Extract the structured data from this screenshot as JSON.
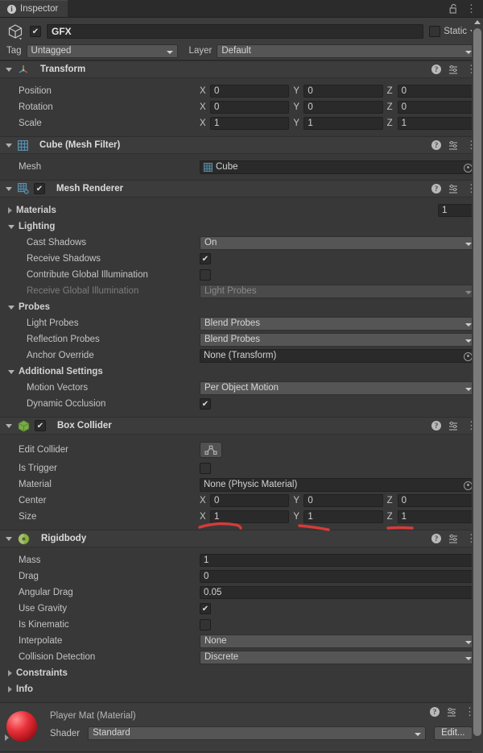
{
  "window": {
    "tab_label": "Inspector",
    "tab_icon": "info-icon",
    "lock_icon": "lock-open-icon",
    "menu_icon": "kebab-menu-icon"
  },
  "object_header": {
    "icon": "cube-icon",
    "enabled": true,
    "name": "GFX",
    "static_label": "Static",
    "static_checked": false,
    "tag_label": "Tag",
    "tag_value": "Untagged",
    "layer_label": "Layer",
    "layer_value": "Default"
  },
  "components": [
    {
      "id": "transform",
      "title": "Transform",
      "icon": "transform-axis-icon",
      "expanded": true,
      "has_checkbox": false,
      "rows": [
        {
          "type": "vector3",
          "label": "Position",
          "x": "0",
          "y": "0",
          "z": "0"
        },
        {
          "type": "vector3",
          "label": "Rotation",
          "x": "0",
          "y": "0",
          "z": "0"
        },
        {
          "type": "vector3",
          "label": "Scale",
          "x": "1",
          "y": "1",
          "z": "1"
        }
      ]
    },
    {
      "id": "mesh-filter",
      "title": "Cube (Mesh Filter)",
      "icon": "mesh-filter-icon",
      "expanded": true,
      "has_checkbox": false,
      "rows": [
        {
          "type": "object",
          "label": "Mesh",
          "value": "Cube",
          "value_icon": "mesh-icon"
        }
      ]
    },
    {
      "id": "mesh-renderer",
      "title": "Mesh Renderer",
      "icon": "mesh-renderer-icon",
      "expanded": true,
      "has_checkbox": true,
      "checked": true,
      "rows": [
        {
          "type": "foldout-num",
          "label": "Materials",
          "open": false,
          "value": "1"
        },
        {
          "type": "foldout",
          "label": "Lighting",
          "open": true
        },
        {
          "type": "dropdown",
          "label": "Cast Shadows",
          "value": "On",
          "indent": 2
        },
        {
          "type": "checkbox",
          "label": "Receive Shadows",
          "checked": true,
          "indent": 2
        },
        {
          "type": "checkbox",
          "label": "Contribute Global Illumination",
          "checked": false,
          "indent": 2
        },
        {
          "type": "dropdown",
          "label": "Receive Global Illumination",
          "value": "Light Probes",
          "indent": 2,
          "disabled": true
        },
        {
          "type": "foldout",
          "label": "Probes",
          "open": true
        },
        {
          "type": "dropdown",
          "label": "Light Probes",
          "value": "Blend Probes",
          "indent": 2
        },
        {
          "type": "dropdown",
          "label": "Reflection Probes",
          "value": "Blend Probes",
          "indent": 2
        },
        {
          "type": "object",
          "label": "Anchor Override",
          "value": "None (Transform)",
          "indent": 2
        },
        {
          "type": "foldout",
          "label": "Additional Settings",
          "open": true
        },
        {
          "type": "dropdown",
          "label": "Motion Vectors",
          "value": "Per Object Motion",
          "indent": 2
        },
        {
          "type": "checkbox",
          "label": "Dynamic Occlusion",
          "checked": true,
          "indent": 2
        }
      ]
    },
    {
      "id": "box-collider",
      "title": "Box Collider",
      "icon": "box-collider-icon",
      "expanded": true,
      "has_checkbox": true,
      "checked": true,
      "rows": [
        {
          "type": "button",
          "label": "Edit Collider",
          "button_icon": "edit-collider-icon"
        },
        {
          "type": "checkbox",
          "label": "Is Trigger",
          "checked": false
        },
        {
          "type": "object",
          "label": "Material",
          "value": "None (Physic Material)"
        },
        {
          "type": "vector3",
          "label": "Center",
          "x": "0",
          "y": "0",
          "z": "0"
        },
        {
          "type": "vector3",
          "label": "Size",
          "x": "1",
          "y": "1",
          "z": "1",
          "annotated": true
        }
      ]
    },
    {
      "id": "rigidbody",
      "title": "Rigidbody",
      "icon": "rigidbody-icon",
      "expanded": true,
      "has_checkbox": false,
      "rows": [
        {
          "type": "text",
          "label": "Mass",
          "value": "1"
        },
        {
          "type": "text",
          "label": "Drag",
          "value": "0"
        },
        {
          "type": "text",
          "label": "Angular Drag",
          "value": "0.05"
        },
        {
          "type": "checkbox",
          "label": "Use Gravity",
          "checked": true
        },
        {
          "type": "checkbox",
          "label": "Is Kinematic",
          "checked": false
        },
        {
          "type": "dropdown",
          "label": "Interpolate",
          "value": "None"
        },
        {
          "type": "dropdown",
          "label": "Collision Detection",
          "value": "Discrete"
        },
        {
          "type": "foldout",
          "label": "Constraints",
          "open": false
        },
        {
          "type": "foldout",
          "label": "Info",
          "open": false
        }
      ]
    }
  ],
  "material_preview": {
    "title": "Player Mat (Material)",
    "sphere_color": "#e8313a",
    "shader_label": "Shader",
    "shader_value": "Standard",
    "edit_button": "Edit...",
    "help_icon": "help-icon",
    "preset_icon": "preset-icon",
    "menu_icon": "kebab-menu-icon"
  },
  "annotations": {
    "color": "#d63b3b",
    "marks": [
      {
        "name": "size-x-underline"
      },
      {
        "name": "size-y-underline"
      },
      {
        "name": "size-z-underline"
      }
    ]
  },
  "scrollbar": {
    "name": "vertical-scrollbar"
  }
}
